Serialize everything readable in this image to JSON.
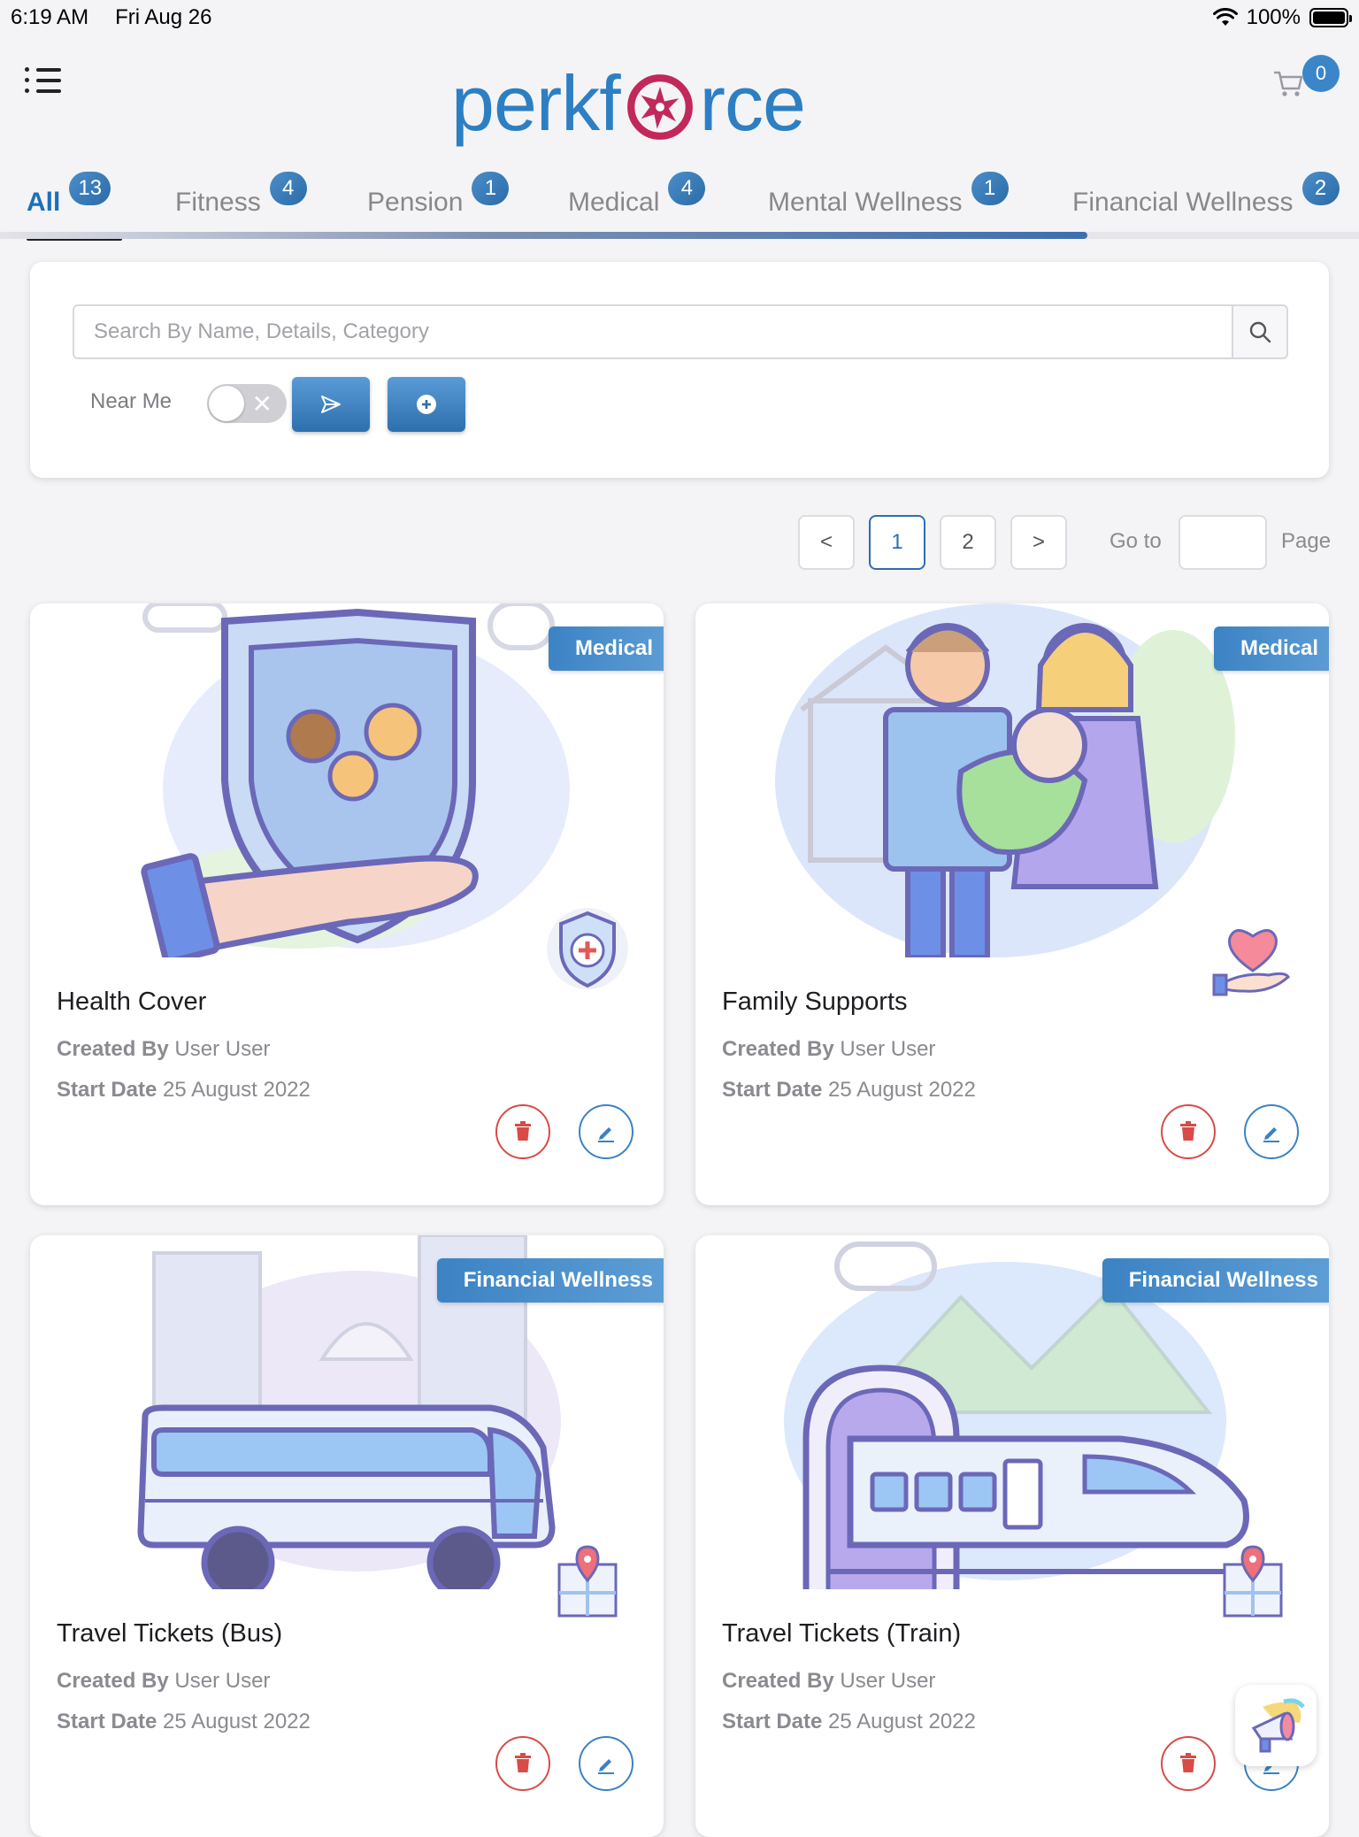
{
  "status_bar": {
    "time": "6:19 AM",
    "date": "Fri Aug 26",
    "battery": "100%"
  },
  "header": {
    "logo_text_left": "perkf",
    "logo_text_right": "rce",
    "cart_count": "0"
  },
  "tabs": [
    {
      "label": "All",
      "count": "13",
      "active": true
    },
    {
      "label": "Fitness",
      "count": "4"
    },
    {
      "label": "Pension",
      "count": "1"
    },
    {
      "label": "Medical",
      "count": "4"
    },
    {
      "label": "Mental Wellness",
      "count": "1"
    },
    {
      "label": "Financial Wellness",
      "count": "2"
    }
  ],
  "tab_scroll_progress": 0.8,
  "search": {
    "placeholder": "Search By Name, Details, Category",
    "value": "",
    "near_me_label": "Near Me",
    "near_me_on": false
  },
  "pagination": {
    "pages": [
      "1",
      "2"
    ],
    "current": "1",
    "goto_label": "Go to",
    "page_label": "Page",
    "prev": "<",
    "next": ">"
  },
  "cards": [
    {
      "title": "Health Cover",
      "tag": "Medical",
      "created_by_label": "Created By",
      "created_by": "User User",
      "start_date_label": "Start Date",
      "start_date": "25 August 2022"
    },
    {
      "title": "Family Supports",
      "tag": "Medical",
      "created_by_label": "Created By",
      "created_by": "User User",
      "start_date_label": "Start Date",
      "start_date": "25 August 2022"
    },
    {
      "title": "Travel Tickets (Bus)",
      "tag": "Financial Wellness",
      "created_by_label": "Created By",
      "created_by": "User User",
      "start_date_label": "Start Date",
      "start_date": "25 August 2022"
    },
    {
      "title": "Travel Tickets (Train)",
      "tag": "Financial Wellness",
      "created_by_label": "Created By",
      "created_by": "User User",
      "start_date_label": "Start Date",
      "start_date": "25 August 2022"
    }
  ],
  "colors": {
    "accent": "#2d6fae",
    "brand_blue": "#2d7fc4",
    "brand_magenta": "#c2285a",
    "delete": "#d94b46",
    "edit": "#3a82c4"
  },
  "icons": [
    "menu-icon",
    "cart-icon",
    "search-icon",
    "send-icon",
    "add-circle-icon",
    "delete-icon",
    "edit-icon",
    "megaphone-icon",
    "wifi-icon",
    "battery-icon"
  ]
}
